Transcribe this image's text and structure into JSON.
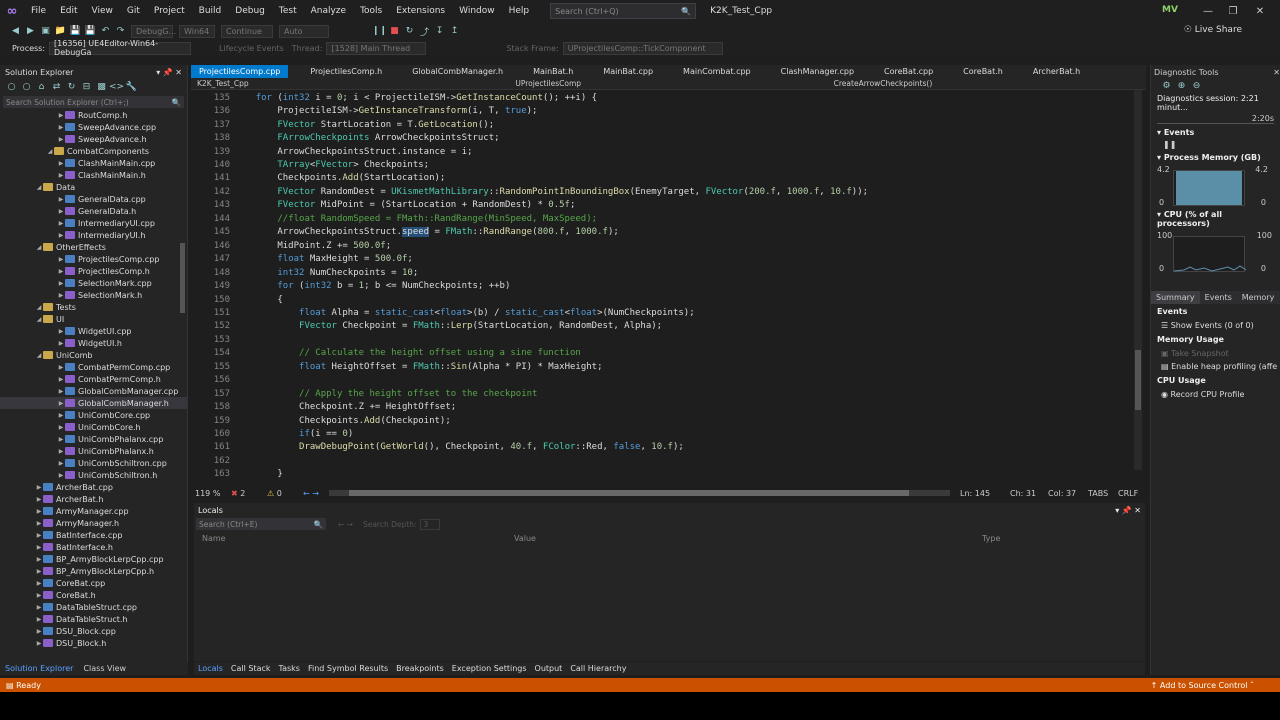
{
  "menubar": {
    "items": [
      "File",
      "Edit",
      "View",
      "Git",
      "Project",
      "Build",
      "Debug",
      "Test",
      "Analyze",
      "Tools",
      "Extensions",
      "Window",
      "Help"
    ],
    "search_placeholder": "Search (Ctrl+Q)",
    "solution_name": "K2K_Test_Cpp",
    "avatar": "MV"
  },
  "toolbar": {
    "config": "DebugG...",
    "platform": "Win64",
    "continue": "Continue",
    "auto": "Auto",
    "live_share": "Live Share"
  },
  "procbar": {
    "process_label": "Process:",
    "process_value": "[16356] UE4Editor-Win64-DebugGa",
    "lifecycle": "Lifecycle Events",
    "thread_label": "Thread:",
    "thread_value": "[1528] Main Thread",
    "stackframe_label": "Stack Frame:",
    "stackframe_value": "UProjectilesComp::TickComponent"
  },
  "solution_explorer": {
    "title": "Solution Explorer",
    "search_placeholder": "Search Solution Explorer (Ctrl+;)",
    "items": [
      {
        "label": "RoutComp.h",
        "type": "h",
        "indent": 5
      },
      {
        "label": "SweepAdvance.cpp",
        "type": "cpp",
        "indent": 5
      },
      {
        "label": "SweepAdvance.h",
        "type": "h",
        "indent": 5
      },
      {
        "label": "CombatComponents",
        "type": "folder",
        "indent": 4
      },
      {
        "label": "ClashMainMain.cpp",
        "type": "cpp",
        "indent": 5
      },
      {
        "label": "ClashMainMain.h",
        "type": "h",
        "indent": 5
      },
      {
        "label": "Data",
        "type": "folder",
        "indent": 3
      },
      {
        "label": "GeneralData.cpp",
        "type": "cpp",
        "indent": 5
      },
      {
        "label": "GeneralData.h",
        "type": "h",
        "indent": 5
      },
      {
        "label": "IntermediaryUI.cpp",
        "type": "cpp",
        "indent": 5
      },
      {
        "label": "IntermediaryUI.h",
        "type": "h",
        "indent": 5
      },
      {
        "label": "OtherEffects",
        "type": "folder",
        "indent": 3
      },
      {
        "label": "ProjectilesComp.cpp",
        "type": "cpp",
        "indent": 5
      },
      {
        "label": "ProjectilesComp.h",
        "type": "h",
        "indent": 5
      },
      {
        "label": "SelectionMark.cpp",
        "type": "cpp",
        "indent": 5
      },
      {
        "label": "SelectionMark.h",
        "type": "h",
        "indent": 5
      },
      {
        "label": "Tests",
        "type": "folder",
        "indent": 3
      },
      {
        "label": "UI",
        "type": "folder",
        "indent": 3
      },
      {
        "label": "WidgetUI.cpp",
        "type": "cpp",
        "indent": 5
      },
      {
        "label": "WidgetUI.h",
        "type": "h",
        "indent": 5
      },
      {
        "label": "UniComb",
        "type": "folder",
        "indent": 3
      },
      {
        "label": "CombatPermComp.cpp",
        "type": "cpp",
        "indent": 5
      },
      {
        "label": "CombatPermComp.h",
        "type": "h",
        "indent": 5
      },
      {
        "label": "GlobalCombManager.cpp",
        "type": "cpp",
        "indent": 5
      },
      {
        "label": "GlobalCombManager.h",
        "type": "h",
        "indent": 5,
        "selected": true
      },
      {
        "label": "UniCombCore.cpp",
        "type": "cpp",
        "indent": 5
      },
      {
        "label": "UniCombCore.h",
        "type": "h",
        "indent": 5
      },
      {
        "label": "UniCombPhalanx.cpp",
        "type": "cpp",
        "indent": 5
      },
      {
        "label": "UniCombPhalanx.h",
        "type": "h",
        "indent": 5
      },
      {
        "label": "UniCombSchiltron.cpp",
        "type": "cpp",
        "indent": 5
      },
      {
        "label": "UniCombSchiltron.h",
        "type": "h",
        "indent": 5
      },
      {
        "label": "ArcherBat.cpp",
        "type": "cpp",
        "indent": 3
      },
      {
        "label": "ArcherBat.h",
        "type": "h",
        "indent": 3
      },
      {
        "label": "ArmyManager.cpp",
        "type": "cpp",
        "indent": 3
      },
      {
        "label": "ArmyManager.h",
        "type": "h",
        "indent": 3
      },
      {
        "label": "BatInterface.cpp",
        "type": "cpp",
        "indent": 3
      },
      {
        "label": "BatInterface.h",
        "type": "h",
        "indent": 3
      },
      {
        "label": "BP_ArmyBlockLerpCpp.cpp",
        "type": "cpp",
        "indent": 3
      },
      {
        "label": "BP_ArmyBlockLerpCpp.h",
        "type": "h",
        "indent": 3
      },
      {
        "label": "CoreBat.cpp",
        "type": "cpp",
        "indent": 3
      },
      {
        "label": "CoreBat.h",
        "type": "h",
        "indent": 3
      },
      {
        "label": "DataTableStruct.cpp",
        "type": "cpp",
        "indent": 3
      },
      {
        "label": "DataTableStruct.h",
        "type": "h",
        "indent": 3
      },
      {
        "label": "DSU_Block.cpp",
        "type": "cpp",
        "indent": 3
      },
      {
        "label": "DSU_Block.h",
        "type": "h",
        "indent": 3
      }
    ],
    "bottom_tabs": [
      "Solution Explorer",
      "Class View"
    ]
  },
  "editor": {
    "tabs": [
      "ProjectilesComp.cpp",
      "ProjectilesComp.h",
      "GlobalCombManager.h",
      "MainBat.h",
      "MainBat.cpp",
      "MainCombat.cpp",
      "ClashManager.cpp",
      "CoreBat.cpp",
      "CoreBat.h",
      "ArcherBat.h"
    ],
    "nav_project": "K2K_Test_Cpp",
    "nav_class": "UProjectilesComp",
    "nav_member": "CreateArrowCheckpoints()",
    "zoom": "119 %",
    "errors": "2",
    "warnings": "0",
    "ln": "Ln: 145",
    "ch": "Ch: 31",
    "col": "Col: 37",
    "tabs_mode": "TABS",
    "eol": "CRLF"
  },
  "code_lines": [
    {
      "n": "135",
      "t": "    for (int32 i = 0; i < ProjectileISM->GetInstanceCount(); ++i) {"
    },
    {
      "n": "136",
      "t": "        ProjectileISM->GetInstanceTransform(i, T, true);"
    },
    {
      "n": "137",
      "t": "        FVector StartLocation = T.GetLocation();"
    },
    {
      "n": "138",
      "t": "        FArrowCheckpoints ArrowCheckpointsStruct;"
    },
    {
      "n": "139",
      "t": "        ArrowCheckpointsStruct.instance = i;"
    },
    {
      "n": "140",
      "t": "        TArray<FVector> Checkpoints;"
    },
    {
      "n": "141",
      "t": "        Checkpoints.Add(StartLocation);"
    },
    {
      "n": "142",
      "t": "        FVector RandomDest = UKismetMathLibrary::RandomPointInBoundingBox(EnemyTarget, FVector(200.f, 1000.f, 10.f));"
    },
    {
      "n": "143",
      "t": "        FVector MidPoint = (StartLocation + RandomDest) * 0.5f;"
    },
    {
      "n": "144",
      "t": "        //float RandomSpeed = FMath::RandRange(MinSpeed, MaxSpeed);"
    },
    {
      "n": "145",
      "t": "        ArrowCheckpointsStruct.speed = FMath::RandRange(800.f, 1000.f);"
    },
    {
      "n": "146",
      "t": "        MidPoint.Z += 500.0f;"
    },
    {
      "n": "147",
      "t": "        float MaxHeight = 500.0f;"
    },
    {
      "n": "148",
      "t": "        int32 NumCheckpoints = 10;"
    },
    {
      "n": "149",
      "t": "        for (int32 b = 1; b <= NumCheckpoints; ++b)"
    },
    {
      "n": "150",
      "t": "        {"
    },
    {
      "n": "151",
      "t": "            float Alpha = static_cast<float>(b) / static_cast<float>(NumCheckpoints);"
    },
    {
      "n": "152",
      "t": "            FVector Checkpoint = FMath::Lerp(StartLocation, RandomDest, Alpha);"
    },
    {
      "n": "153",
      "t": ""
    },
    {
      "n": "154",
      "t": "            // Calculate the height offset using a sine function"
    },
    {
      "n": "155",
      "t": "            float HeightOffset = FMath::Sin(Alpha * PI) * MaxHeight;"
    },
    {
      "n": "156",
      "t": ""
    },
    {
      "n": "157",
      "t": "            // Apply the height offset to the checkpoint"
    },
    {
      "n": "158",
      "t": "            Checkpoint.Z += HeightOffset;"
    },
    {
      "n": "159",
      "t": "            Checkpoints.Add(Checkpoint);"
    },
    {
      "n": "160",
      "t": "            if(i == 0)"
    },
    {
      "n": "161",
      "t": "            DrawDebugPoint(GetWorld(), Checkpoint, 40.f, FColor::Red, false, 10.f);"
    },
    {
      "n": "162",
      "t": ""
    },
    {
      "n": "163",
      "t": "        }"
    }
  ],
  "diagnostics": {
    "title": "Diagnostic Tools",
    "session": "Diagnostics session: 2:21 minut...",
    "time_marker": "2:20s",
    "events": "Events",
    "process_memory": "Process Memory (GB)",
    "mem_max": "4.2",
    "mem_min": "0",
    "cpu": "CPU (% of all processors)",
    "cpu_max": "100",
    "cpu_min": "0",
    "tabs": [
      "Summary",
      "Events",
      "Memory"
    ],
    "events_hdr": "Events",
    "show_events": "Show Events (0 of 0)",
    "memory_usage": "Memory Usage",
    "take_snapshot": "Take Snapshot",
    "heap_profiling": "Enable heap profiling (affe",
    "cpu_usage": "CPU Usage",
    "record_cpu": "Record CPU Profile"
  },
  "locals": {
    "title": "Locals",
    "search_placeholder": "Search (Ctrl+E)",
    "search_depth": "Search Depth:",
    "depth_value": "3",
    "cols": [
      "Name",
      "Value",
      "Type"
    ]
  },
  "bottom_tabs": [
    "Locals",
    "Call Stack",
    "Tasks",
    "Find Symbol Results",
    "Breakpoints",
    "Exception Settings",
    "Output",
    "Call Hierarchy"
  ],
  "status": {
    "ready": "Ready",
    "source_control": "Add to Source Control"
  }
}
